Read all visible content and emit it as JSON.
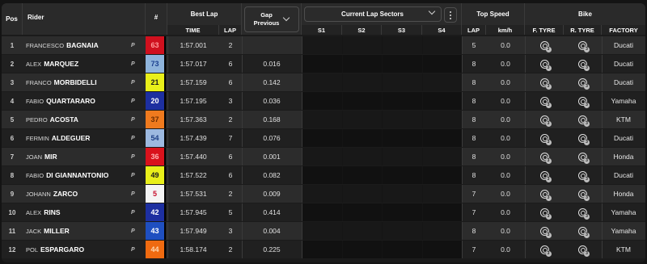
{
  "header": {
    "pos": "Pos",
    "rider": "Rider",
    "number": "#",
    "best_lap": "Best Lap",
    "time": "TIME",
    "lap": "LAP",
    "gap_line1": "Gap",
    "gap_line2": "Previous",
    "sectors_title": "Current Lap Sectors",
    "s1": "S1",
    "s2": "S2",
    "s3": "S3",
    "s4": "S4",
    "top_speed": "Top Speed",
    "ts_lap": "LAP",
    "kmh": "km/h",
    "bike": "Bike",
    "f_tyre": "F. TYRE",
    "r_tyre": "R. TYRE",
    "factory": "FACTORY"
  },
  "rows": [
    {
      "pos": "1",
      "first": "FRANCESCO",
      "last": "BAGNAIA",
      "p": "P",
      "num": "63",
      "num_bg": "#d0101e",
      "num_fg": "#ff9a9a",
      "time": "1:57.001",
      "lap": "2",
      "gap": "",
      "top_lap": "5",
      "kmh": "0.0",
      "ft": "S",
      "rt": "S",
      "factory": "Ducati"
    },
    {
      "pos": "2",
      "first": "ALEX",
      "last": "MARQUEZ",
      "p": "P",
      "num": "73",
      "num_bg": "#8fb4dc",
      "num_fg": "#1b3f8f",
      "time": "1:57.017",
      "lap": "6",
      "gap": "0.016",
      "top_lap": "8",
      "kmh": "0.0",
      "ft": "S",
      "rt": "S",
      "factory": "Ducati"
    },
    {
      "pos": "3",
      "first": "FRANCO",
      "last": "MORBIDELLI",
      "p": "P",
      "num": "21",
      "num_bg": "#e9ef1a",
      "num_fg": "#1a1a1a",
      "time": "1:57.159",
      "lap": "6",
      "gap": "0.142",
      "top_lap": "8",
      "kmh": "0.0",
      "ft": "S",
      "rt": "S",
      "factory": "Ducati"
    },
    {
      "pos": "4",
      "first": "FABIO",
      "last": "QUARTARARO",
      "p": "P",
      "num": "20",
      "num_bg": "#1d2fa0",
      "num_fg": "#ffffff",
      "time": "1:57.195",
      "lap": "3",
      "gap": "0.036",
      "top_lap": "8",
      "kmh": "0.0",
      "ft": "S",
      "rt": "S",
      "factory": "Yamaha"
    },
    {
      "pos": "5",
      "first": "PEDRO",
      "last": "ACOSTA",
      "p": "P",
      "num": "37",
      "num_bg": "#ef7a1e",
      "num_fg": "#6b2c00",
      "time": "1:57.363",
      "lap": "2",
      "gap": "0.168",
      "top_lap": "8",
      "kmh": "0.0",
      "ft": "S",
      "rt": "S",
      "factory": "KTM"
    },
    {
      "pos": "6",
      "first": "FERMIN",
      "last": "ALDEGUER",
      "p": "P",
      "num": "54",
      "num_bg": "#9db9e0",
      "num_fg": "#1e3f86",
      "time": "1:57.439",
      "lap": "7",
      "gap": "0.076",
      "top_lap": "8",
      "kmh": "0.0",
      "ft": "S",
      "rt": "S",
      "factory": "Ducati"
    },
    {
      "pos": "7",
      "first": "JOAN",
      "last": "MIR",
      "p": "P",
      "num": "36",
      "num_bg": "#d9121c",
      "num_fg": "#ffb3b3",
      "time": "1:57.440",
      "lap": "6",
      "gap": "0.001",
      "top_lap": "8",
      "kmh": "0.0",
      "ft": "S",
      "rt": "S",
      "factory": "Honda"
    },
    {
      "pos": "8",
      "first": "FABIO",
      "last": "DI GIANNANTONIO",
      "p": "P",
      "num": "49",
      "num_bg": "#e9ef1a",
      "num_fg": "#1a1a1a",
      "time": "1:57.522",
      "lap": "6",
      "gap": "0.082",
      "top_lap": "8",
      "kmh": "0.0",
      "ft": "S",
      "rt": "S",
      "factory": "Ducati"
    },
    {
      "pos": "9",
      "first": "JOHANN",
      "last": "ZARCO",
      "p": "P",
      "num": "5",
      "num_bg": "#f4f4f4",
      "num_fg": "#c8102e",
      "time": "1:57.531",
      "lap": "2",
      "gap": "0.009",
      "top_lap": "7",
      "kmh": "0.0",
      "ft": "S",
      "rt": "S",
      "factory": "Honda"
    },
    {
      "pos": "10",
      "first": "ALEX",
      "last": "RINS",
      "p": "P",
      "num": "42",
      "num_bg": "#1d2fa0",
      "num_fg": "#ffffff",
      "time": "1:57.945",
      "lap": "5",
      "gap": "0.414",
      "top_lap": "7",
      "kmh": "0.0",
      "ft": "S",
      "rt": "S",
      "factory": "Yamaha"
    },
    {
      "pos": "11",
      "first": "JACK",
      "last": "MILLER",
      "p": "P",
      "num": "43",
      "num_bg": "#1f4fc0",
      "num_fg": "#ffffff",
      "time": "1:57.949",
      "lap": "3",
      "gap": "0.004",
      "top_lap": "8",
      "kmh": "0.0",
      "ft": "S",
      "rt": "S",
      "factory": "Yamaha"
    },
    {
      "pos": "12",
      "first": "POL",
      "last": "ESPARGARO",
      "p": "P",
      "num": "44",
      "num_bg": "#ef6a10",
      "num_fg": "#ffd8b0",
      "time": "1:58.174",
      "lap": "2",
      "gap": "0.225",
      "top_lap": "7",
      "kmh": "0.0",
      "ft": "S",
      "rt": "S",
      "factory": "KTM"
    }
  ],
  "tyre_compound_badges": {
    "f": [
      "3",
      "3",
      "3",
      "3",
      "3",
      "3",
      "3",
      "3",
      "3",
      "3",
      "3",
      "3"
    ],
    "r": [
      "3",
      "3",
      "3",
      "3",
      "3",
      "3",
      "3",
      "3",
      "3",
      "3",
      "3",
      "3"
    ]
  },
  "colors": {
    "row_light": "#2c2c2c",
    "row_dark": "#202020"
  }
}
